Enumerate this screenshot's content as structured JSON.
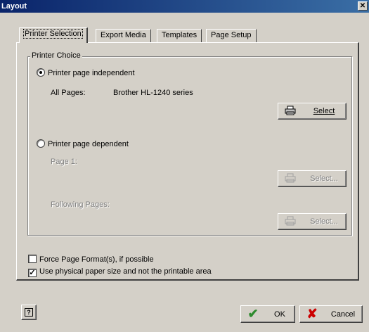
{
  "window": {
    "title": "Layout",
    "close_glyph": "✕"
  },
  "tabs": [
    {
      "label": "Printer Selection"
    },
    {
      "label": "Export Media"
    },
    {
      "label": "Templates"
    },
    {
      "label": "Page Setup"
    }
  ],
  "printer_choice": {
    "group_label": "Printer Choice",
    "independent": {
      "label": "Printer page independent",
      "checked": true
    },
    "all_pages_label": "All Pages:",
    "all_pages_value": "Brother HL-1240 series",
    "select_label": "Select",
    "dependent": {
      "label": "Printer page dependent",
      "checked": false
    },
    "page1_label": "Page 1:",
    "page1_select_label": "Select...",
    "following_label": "Following Pages:",
    "following_select_label": "Select..."
  },
  "options": {
    "force_format": {
      "label": "Force Page Format(s), if possible",
      "checked": false
    },
    "physical_paper": {
      "label": "Use physical paper size and not the printable area",
      "checked": true
    }
  },
  "footer": {
    "help_glyph": "?",
    "ok_label": "OK",
    "cancel_label": "Cancel"
  },
  "icons": {
    "printer": "printer-icon",
    "ok": "check-icon",
    "cancel": "x-icon",
    "help": "help-icon"
  },
  "colors": {
    "ok_green": "#2e8b2e",
    "cancel_red": "#cc0000",
    "titlebar": "#0a246a"
  }
}
